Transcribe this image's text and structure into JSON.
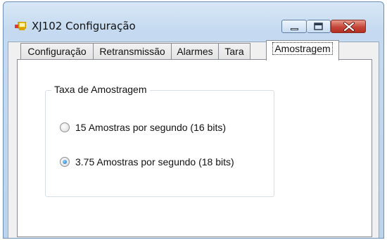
{
  "window": {
    "title": "XJ102 Configuração",
    "controls": {
      "minimize": "minimize",
      "maximize": "maximize",
      "close": "close"
    }
  },
  "tabs": [
    {
      "label": "Configuração",
      "selected": false
    },
    {
      "label": "Retransmissão",
      "selected": false
    },
    {
      "label": "Alarmes",
      "selected": false
    },
    {
      "label": "Tara",
      "selected": false
    },
    {
      "label": "Amostragem",
      "selected": true
    }
  ],
  "groupbox": {
    "legend": "Taxa de Amostragem",
    "options": [
      {
        "label": "15 Amostras por segundo (16 bits)",
        "checked": false
      },
      {
        "label": "3.75 Amostras por segundo (18 bits)",
        "checked": true
      }
    ]
  },
  "colors": {
    "accent": "#1d6fbf",
    "close": "#c6473a"
  }
}
